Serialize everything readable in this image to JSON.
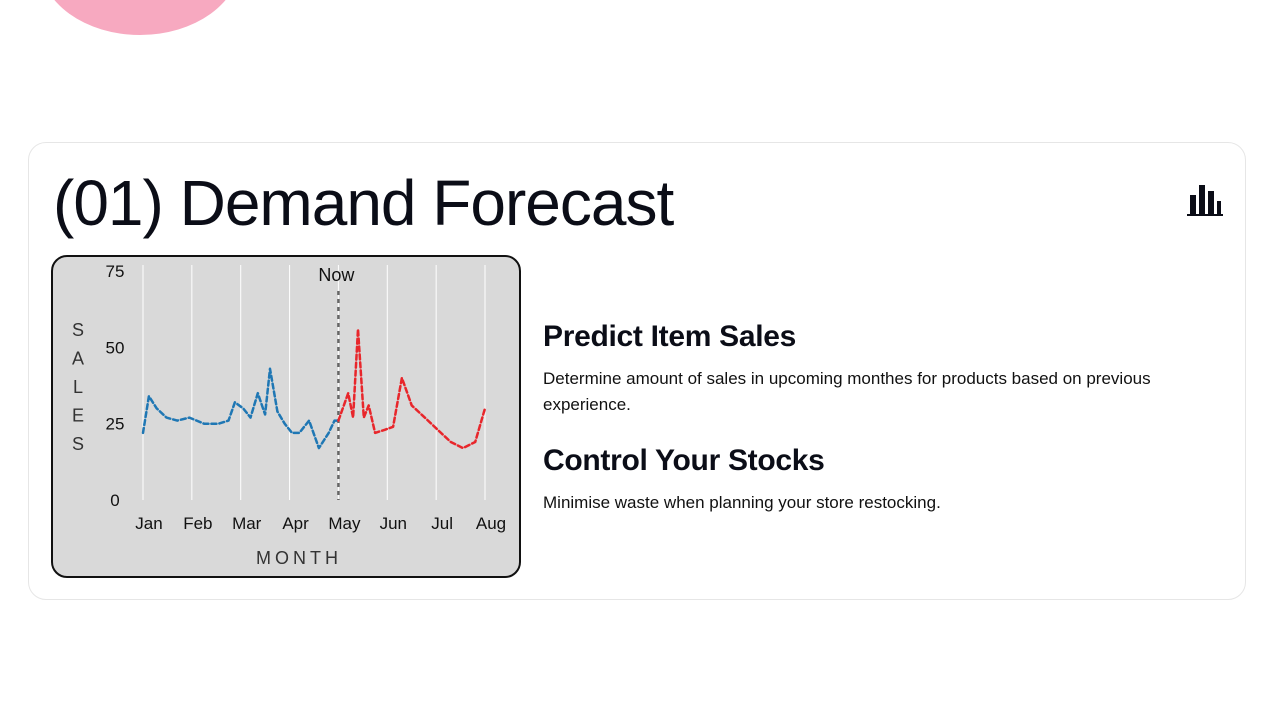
{
  "card": {
    "title": "(01) Demand Forecast",
    "icon": "bar-chart-icon"
  },
  "features": [
    {
      "title": "Predict Item Sales",
      "description": "Determine amount of sales in upcoming monthes for products based on previous experience."
    },
    {
      "title": "Control Your Stocks",
      "description": "Minimise waste when planning your store restocking."
    }
  ],
  "colors": {
    "history": "#1f77b4",
    "forecast": "#e8262b",
    "now_line": "#666666",
    "chart_bg": "#d9d9d9",
    "blob": "#f7a9c0"
  },
  "chart_data": {
    "type": "line",
    "xlabel": "MONTH",
    "ylabel": "SALES",
    "categories": [
      "Jan",
      "Feb",
      "Mar",
      "Apr",
      "May",
      "Jun",
      "Jul",
      "Aug"
    ],
    "yticks": [
      0,
      25,
      50,
      75
    ],
    "ylim": [
      0,
      77
    ],
    "xlim": [
      0,
      7
    ],
    "grid": "vertical",
    "annotations": [
      {
        "text": "Now",
        "x": 4.0
      }
    ],
    "series": [
      {
        "values": [
          [
            0.0,
            22
          ],
          [
            0.12,
            34
          ],
          [
            0.28,
            30
          ],
          [
            0.48,
            27
          ],
          [
            0.7,
            26
          ],
          [
            0.95,
            27
          ],
          [
            1.25,
            25
          ],
          [
            1.55,
            25
          ],
          [
            1.75,
            26
          ],
          [
            1.88,
            32
          ],
          [
            2.05,
            30
          ],
          [
            2.2,
            27
          ],
          [
            2.35,
            35
          ],
          [
            2.5,
            28
          ],
          [
            2.6,
            43
          ],
          [
            2.75,
            29
          ],
          [
            2.9,
            25
          ],
          [
            3.05,
            22
          ],
          [
            3.2,
            22
          ],
          [
            3.4,
            26
          ],
          [
            3.6,
            17
          ],
          [
            3.8,
            22
          ],
          [
            3.92,
            26
          ],
          [
            4.0,
            26
          ]
        ]
      },
      {
        "values": [
          [
            4.0,
            26
          ],
          [
            4.2,
            35
          ],
          [
            4.3,
            27
          ],
          [
            4.4,
            56
          ],
          [
            4.52,
            27
          ],
          [
            4.62,
            31
          ],
          [
            4.75,
            22
          ],
          [
            4.95,
            23
          ],
          [
            5.12,
            24
          ],
          [
            5.3,
            40
          ],
          [
            5.5,
            31
          ],
          [
            5.7,
            28
          ],
          [
            5.9,
            25
          ],
          [
            6.1,
            22
          ],
          [
            6.3,
            19
          ],
          [
            6.55,
            17
          ],
          [
            6.8,
            19
          ],
          [
            7.0,
            30
          ]
        ]
      }
    ]
  }
}
